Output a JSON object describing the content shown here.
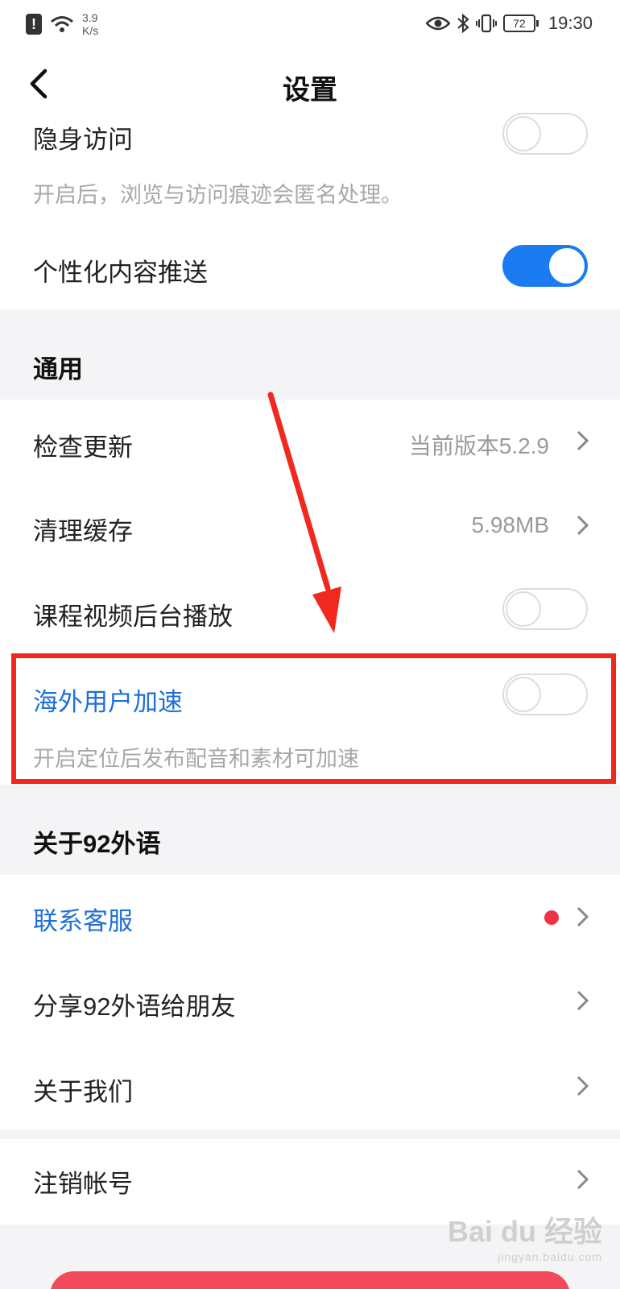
{
  "status_bar": {
    "alert_glyph": "!",
    "net_speed": "3.9\nK/s",
    "battery": "72",
    "time": "19:30"
  },
  "nav": {
    "title": "设置"
  },
  "privacy": {
    "incognito_label": "隐身访问",
    "incognito_desc": "开启后，浏览与访问痕迹会匿名处理。",
    "incognito_on": false,
    "personalized_label": "个性化内容推送",
    "personalized_on": true
  },
  "general": {
    "title": "通用",
    "check_update_label": "检查更新",
    "check_update_value": "当前版本5.2.9",
    "clear_cache_label": "清理缓存",
    "clear_cache_value": "5.98MB",
    "bg_play_label": "课程视频后台播放",
    "bg_play_on": false,
    "overseas_label": "海外用户加速",
    "overseas_desc": "开启定位后发布配音和素材可加速",
    "overseas_on": false
  },
  "about": {
    "title": "关于92外语",
    "contact_label": "联系客服",
    "share_label": "分享92外语给朋友",
    "about_us_label": "关于我们"
  },
  "account": {
    "deregister_label": "注销帐号"
  },
  "watermark": {
    "brand": "Bai du 经验",
    "url": "jingyan.baidu.com"
  },
  "colors": {
    "accent_blue": "#1a7cf0",
    "link_blue": "#1e6fd9",
    "highlight_red": "#f0281e",
    "button_red": "#f24a5a"
  }
}
